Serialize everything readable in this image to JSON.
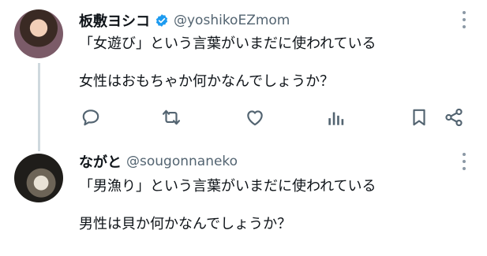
{
  "tweets": [
    {
      "name": "板敷ヨシコ",
      "handle": "@yoshikoEZmom",
      "verified": true,
      "line1": "「女遊び」という言葉がいまだに使われている",
      "line2": "女性はおもちゃか何かなんでしょうか？"
    },
    {
      "name": "ながと",
      "handle": "@sougonnaneko",
      "line1": "「男漁り」という言葉がいまだに使われている",
      "line2": "男性は貝か何かなんでしょうか？"
    }
  ],
  "icons": {
    "reply": "reply-icon",
    "retweet": "retweet-icon",
    "like": "like-icon",
    "views": "views-icon",
    "bookmark": "bookmark-icon",
    "share": "share-icon",
    "more": "more-icon",
    "verified": "verified-badge-icon"
  },
  "colors": {
    "icon": "#536471",
    "verified": "#1d9bf0",
    "thread_line": "#cfd9de"
  }
}
